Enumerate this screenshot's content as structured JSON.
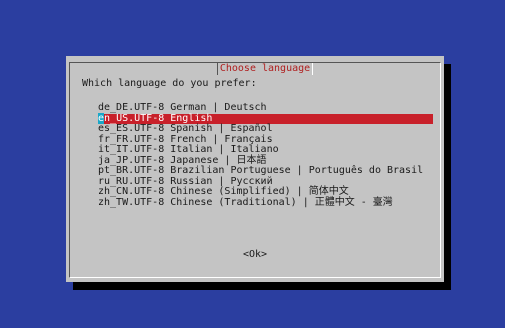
{
  "dialog": {
    "title": "Choose language",
    "prompt": "Which language do you prefer:",
    "ok_label": "<Ok>"
  },
  "languages": [
    {
      "label": "de_DE.UTF-8 German | Deutsch",
      "selected": false
    },
    {
      "label": "en_US.UTF-8 English",
      "selected": true
    },
    {
      "label": "es_ES.UTF-8 Spanish | Español",
      "selected": false
    },
    {
      "label": "fr_FR.UTF-8 French | Français",
      "selected": false
    },
    {
      "label": "it_IT.UTF-8 Italian | Italiano",
      "selected": false
    },
    {
      "label": "ja_JP.UTF-8 Japanese | 日本語",
      "selected": false
    },
    {
      "label": "pt_BR.UTF-8 Brazilian Portuguese | Português do Brasil",
      "selected": false
    },
    {
      "label": "ru_RU.UTF-8 Russian | Русский",
      "selected": false
    },
    {
      "label": "zh_CN.UTF-8 Chinese (Simplified) | 简体中文",
      "selected": false
    },
    {
      "label": "zh_TW.UTF-8 Chinese (Traditional) | 正體中文 - 臺灣",
      "selected": false
    }
  ],
  "colors": {
    "background": "#2b3ea0",
    "dialog": "#c4c4c4",
    "selection": "#c8202a",
    "cursor": "#1aa7c8",
    "title_text": "#b02020"
  }
}
